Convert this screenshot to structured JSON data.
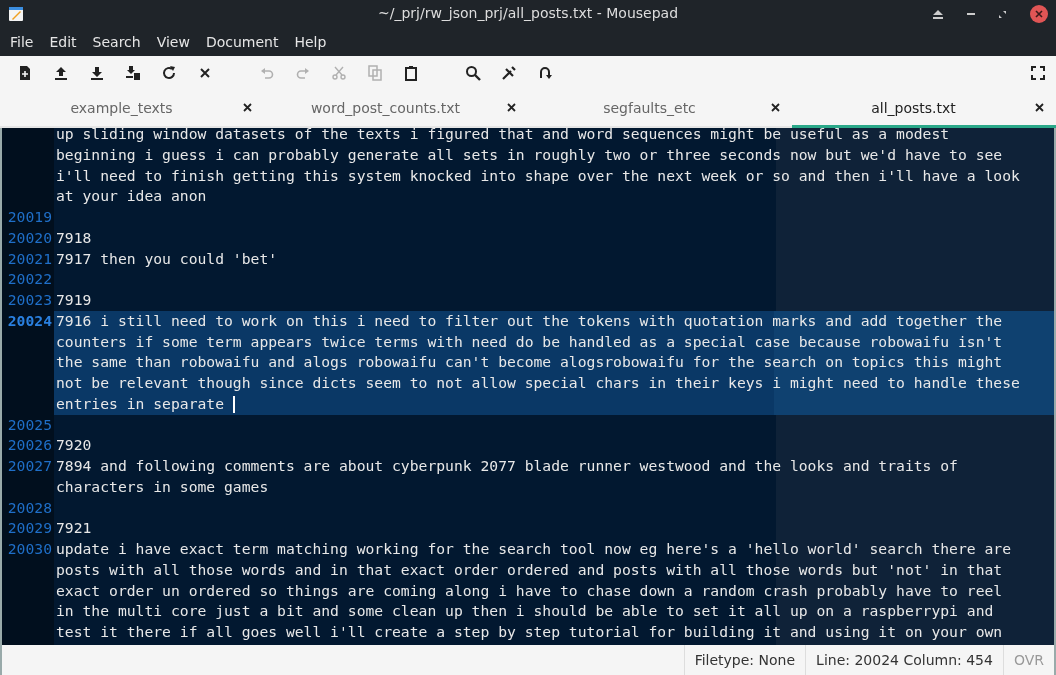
{
  "window": {
    "title": "~/_prj/rw_json_prj/all_posts.txt - Mousepad"
  },
  "menu": [
    "File",
    "Edit",
    "Search",
    "View",
    "Document",
    "Help"
  ],
  "toolbar": [
    {
      "kind": "new",
      "disabled": false
    },
    {
      "kind": "open",
      "disabled": false
    },
    {
      "kind": "save",
      "disabled": false
    },
    {
      "kind": "save-as",
      "disabled": false
    },
    {
      "kind": "reload",
      "disabled": false
    },
    {
      "kind": "close",
      "disabled": false
    },
    {
      "kind": "gap"
    },
    {
      "kind": "undo",
      "disabled": true
    },
    {
      "kind": "redo",
      "disabled": true
    },
    {
      "kind": "cut",
      "disabled": true
    },
    {
      "kind": "copy",
      "disabled": true
    },
    {
      "kind": "paste",
      "disabled": false
    },
    {
      "kind": "gap"
    },
    {
      "kind": "find",
      "disabled": false
    },
    {
      "kind": "replace",
      "disabled": false
    },
    {
      "kind": "goto",
      "disabled": false
    },
    {
      "kind": "spacer"
    },
    {
      "kind": "fullscreen",
      "disabled": false
    }
  ],
  "tabs": [
    {
      "label": "example_texts",
      "selected": false
    },
    {
      "label": "word_post_counts.txt",
      "selected": false
    },
    {
      "label": "segfaults_etc",
      "selected": false
    },
    {
      "label": "all_posts.txt",
      "selected": true
    }
  ],
  "editor": {
    "lines": [
      {
        "current": false,
        "text": [
          "up sliding window datasets of the texts i figured that and word sequences might be useful as a modest",
          "beginning i guess i can probably generate all sets in roughly two or three seconds now but we'd have to see",
          "i'll need to finish getting this system knocked into shape over the next week or so and then i'll have a look",
          "at your idea anon"
        ]
      },
      {
        "number": "20019",
        "current": false
      },
      {
        "number": "20020",
        "current": false,
        "text": [
          "7918"
        ]
      },
      {
        "number": "20021",
        "current": false,
        "text": [
          "7917 then you could 'bet'"
        ]
      },
      {
        "number": "20022",
        "current": false
      },
      {
        "number": "20023",
        "current": false,
        "text": [
          "7919"
        ]
      },
      {
        "number": "20024",
        "current": true,
        "text": [
          "7916 i still need to work on this i need to filter out the tokens with quotation marks and add together the",
          "counters if some term appears twice terms with need do be handled as a special case because robowaifu isn't",
          "the same than robowaifu and alogs robowaifu can't become alogsrobowaifu for the search on topics this might",
          "not be relevant though since dicts seem to not allow special chars in their keys i might need to handle these",
          "entries in separate"
        ]
      },
      {
        "number": "20025",
        "current": false
      },
      {
        "number": "20026",
        "current": false,
        "text": [
          "7920"
        ]
      },
      {
        "number": "20027",
        "current": false,
        "text": [
          "7894 and following comments are about cyberpunk 2077 blade runner westwood and the looks and traits of",
          "characters in some games"
        ]
      },
      {
        "number": "20028",
        "current": false
      },
      {
        "number": "20029",
        "current": false,
        "text": [
          "7921"
        ]
      },
      {
        "number": "20030",
        "current": false,
        "text": [
          "update i have exact term matching working for the search tool now eg here's a 'hello world' search there are",
          "posts with all those words and in that exact order ordered and posts with all those words but 'not' in that",
          "exact order un ordered so things are coming along i have to chase down a random crash probably have to reel",
          "in the multi core just a bit and some clean up then i should be able to set it all up on a raspberrypi and",
          "test it there if all goes well i'll create a step by step tutorial for building it and using it on your own"
        ]
      }
    ]
  },
  "status_bar": {
    "filetype": "Filetype: None",
    "position": "Line: 20024 Column: 454",
    "overwrite": {
      "label": "OVR",
      "on": false
    }
  }
}
